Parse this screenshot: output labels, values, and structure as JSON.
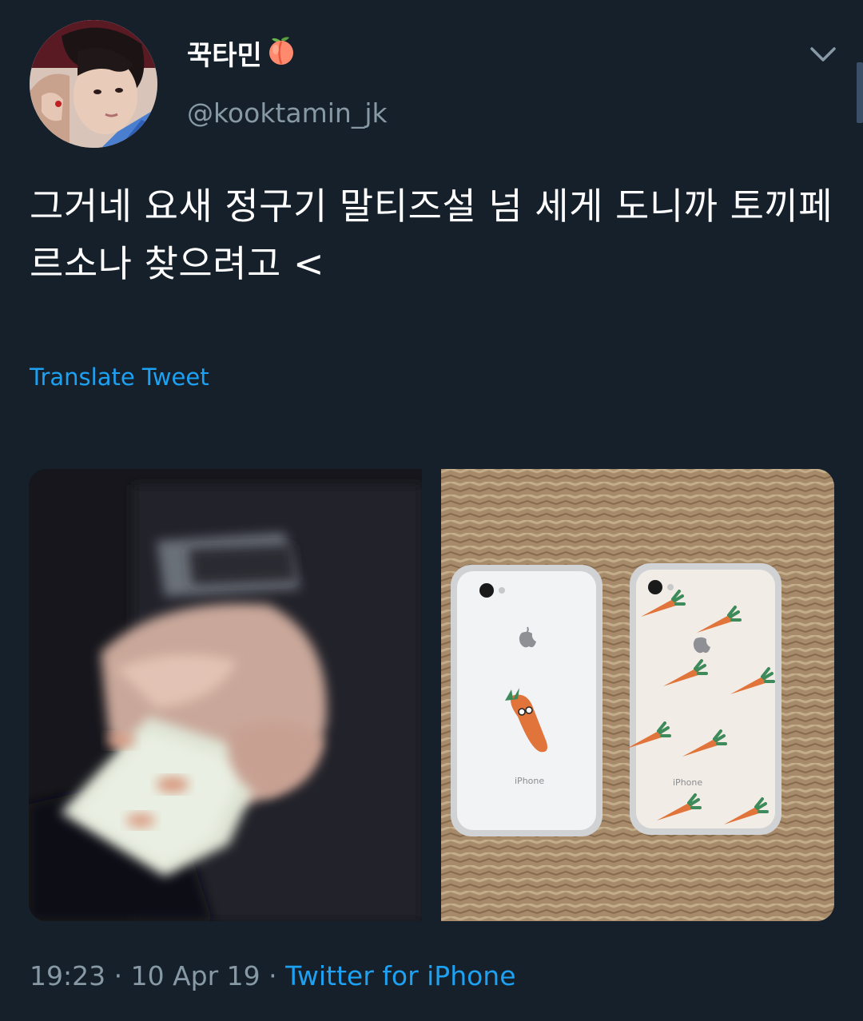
{
  "tweet": {
    "display_name": "꾹타민",
    "name_emoji": "peach-emoji",
    "handle": "@kooktamin_jk",
    "text": "그거네 요새 정구기 말티즈설 넘 세게 도니까 토끼페르소나 찾으려고 <",
    "translate_label": "Translate Tweet",
    "time": "19:23",
    "separator": "·",
    "date": "10 Apr 19",
    "source": "Twitter for iPhone",
    "media": [
      {
        "description_icon": "blurred-hand-holding-phone-image"
      },
      {
        "description_icon": "two-iphone-cases-image",
        "case_label": "iPhone"
      }
    ]
  },
  "colors": {
    "background": "#15202b",
    "primary_text": "#ffffff",
    "secondary_text": "#8899a6",
    "link": "#1da1f2",
    "carrot": "#e0743a",
    "carrot_leaf": "#3d8a5a"
  },
  "icons": {
    "menu": "chevron-down-icon"
  }
}
